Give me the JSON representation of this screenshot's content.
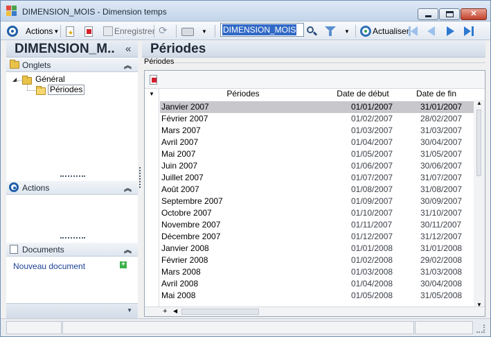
{
  "window": {
    "title": "DIMENSION_MOIS -  Dimension temps"
  },
  "toolbar": {
    "actions_label": "Actions",
    "save_label": "Enregistrer",
    "search_value": "DIMENSION_MOIS",
    "refresh_label": "Actualiser"
  },
  "left_panel": {
    "title": "DIMENSION_M..",
    "collapse_glyph": "«",
    "onglets_label": "Onglets",
    "tree": {
      "general": "Général",
      "periodes": "Périodes"
    },
    "actions_label": "Actions",
    "documents_label": "Documents",
    "new_document_link": "Nouveau document"
  },
  "right_panel": {
    "title": "Périodes",
    "group_label": "Périodes"
  },
  "grid": {
    "columns": [
      "Périodes",
      "Date de début",
      "Date de fin"
    ],
    "rows": [
      [
        "Janvier 2007",
        "01/01/2007",
        "31/01/2007"
      ],
      [
        "Février 2007",
        "01/02/2007",
        "28/02/2007"
      ],
      [
        "Mars 2007",
        "01/03/2007",
        "31/03/2007"
      ],
      [
        "Avril 2007",
        "01/04/2007",
        "30/04/2007"
      ],
      [
        "Mai 2007",
        "01/05/2007",
        "31/05/2007"
      ],
      [
        "Juin 2007",
        "01/06/2007",
        "30/06/2007"
      ],
      [
        "Juillet 2007",
        "01/07/2007",
        "31/07/2007"
      ],
      [
        "Août 2007",
        "01/08/2007",
        "31/08/2007"
      ],
      [
        "Septembre 2007",
        "01/09/2007",
        "30/09/2007"
      ],
      [
        "Octobre 2007",
        "01/10/2007",
        "31/10/2007"
      ],
      [
        "Novembre 2007",
        "01/11/2007",
        "30/11/2007"
      ],
      [
        "Décembre 2007",
        "01/12/2007",
        "31/12/2007"
      ],
      [
        "Janvier 2008",
        "01/01/2008",
        "31/01/2008"
      ],
      [
        "Février 2008",
        "01/02/2008",
        "29/02/2008"
      ],
      [
        "Mars 2008",
        "01/03/2008",
        "31/03/2008"
      ],
      [
        "Avril 2008",
        "01/04/2008",
        "30/04/2008"
      ],
      [
        "Mai 2008",
        "01/05/2008",
        "31/05/2008"
      ]
    ],
    "selected_row": 0
  },
  "icons": {
    "app": "app-logo-icon",
    "actions": "actions-circle-icon",
    "new": "new-document-icon",
    "delete": "delete-icon",
    "save": "save-icon",
    "refresh": "refresh-icon",
    "print": "print-icon",
    "search": "search-icon",
    "filter": "filter-icon",
    "actualiser": "actualiser-icon",
    "first": "first-record-icon",
    "prev": "previous-record-icon",
    "next": "next-record-icon",
    "last": "last-record-icon"
  },
  "colors": {
    "accent_blue": "#1f5fa8",
    "selected_row": "#c8c8cc",
    "link": "#1c3f95",
    "close_red": "#c2402a"
  }
}
